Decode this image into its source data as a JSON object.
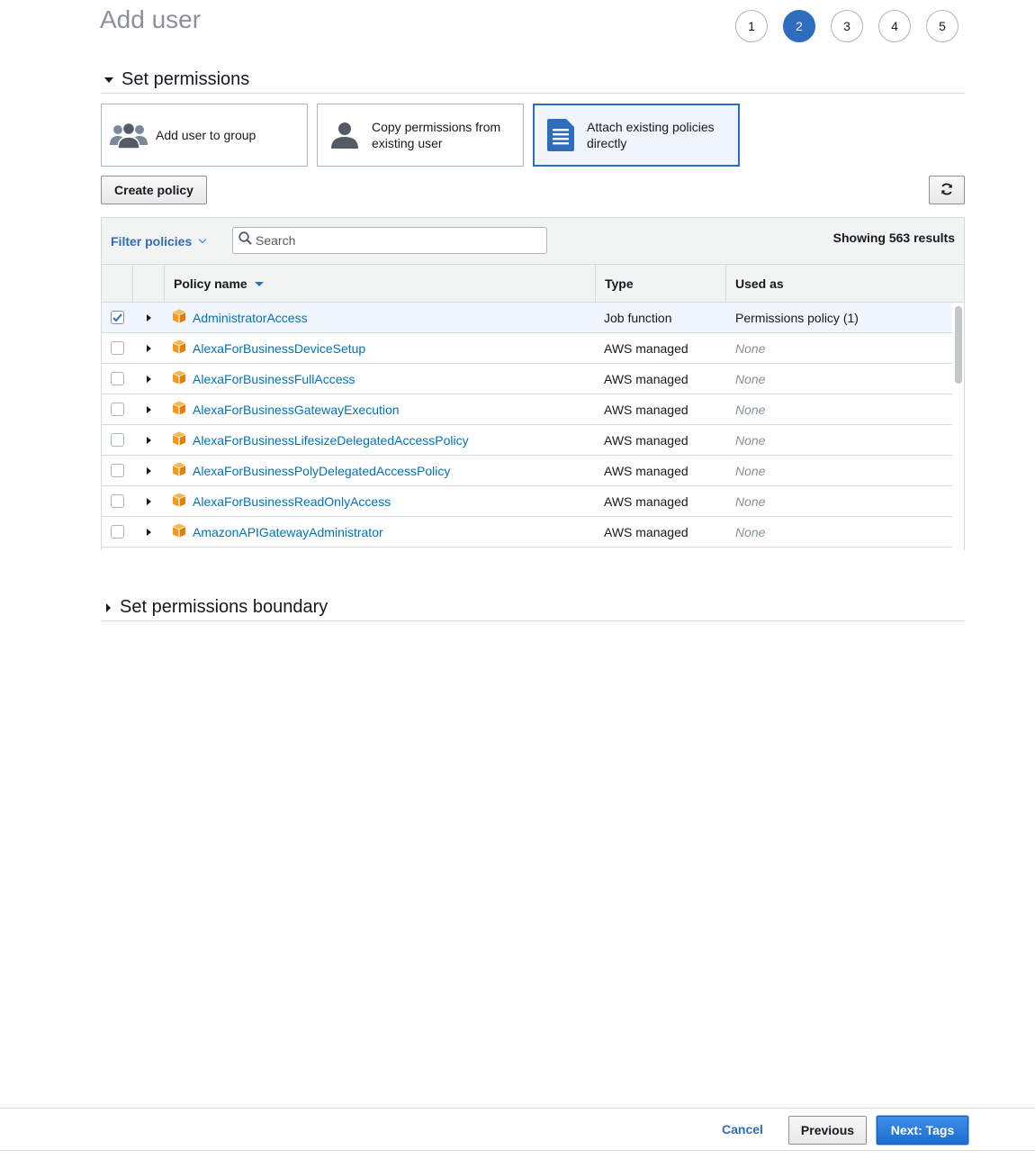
{
  "page": {
    "title": "Add user"
  },
  "steps": [
    {
      "label": "1",
      "active": false
    },
    {
      "label": "2",
      "active": true
    },
    {
      "label": "3",
      "active": false
    },
    {
      "label": "4",
      "active": false
    },
    {
      "label": "5",
      "active": false
    }
  ],
  "permissions": {
    "section_title": "Set permissions",
    "options": [
      {
        "label": "Add user to group",
        "icon": "user-group-icon",
        "selected": false
      },
      {
        "label": "Copy permissions from existing user",
        "icon": "user-icon",
        "selected": false
      },
      {
        "label": "Attach existing policies directly",
        "icon": "document-icon",
        "selected": true
      }
    ],
    "create_policy_label": "Create policy",
    "refresh_icon": "refresh-icon"
  },
  "table": {
    "filter_label": "Filter policies",
    "search_placeholder": "Search",
    "results_text": "Showing 563 results",
    "columns": {
      "name": "Policy name",
      "type": "Type",
      "used_as": "Used as"
    },
    "rows": [
      {
        "name": "AdministratorAccess",
        "type": "Job function",
        "used_as": "Permissions policy (1)",
        "checked": true
      },
      {
        "name": "AlexaForBusinessDeviceSetup",
        "type": "AWS managed",
        "used_as": "None",
        "checked": false
      },
      {
        "name": "AlexaForBusinessFullAccess",
        "type": "AWS managed",
        "used_as": "None",
        "checked": false
      },
      {
        "name": "AlexaForBusinessGatewayExecution",
        "type": "AWS managed",
        "used_as": "None",
        "checked": false
      },
      {
        "name": "AlexaForBusinessLifesizeDelegatedAccessPolicy",
        "type": "AWS managed",
        "used_as": "None",
        "checked": false
      },
      {
        "name": "AlexaForBusinessPolyDelegatedAccessPolicy",
        "type": "AWS managed",
        "used_as": "None",
        "checked": false
      },
      {
        "name": "AlexaForBusinessReadOnlyAccess",
        "type": "AWS managed",
        "used_as": "None",
        "checked": false
      },
      {
        "name": "AmazonAPIGatewayAdministrator",
        "type": "AWS managed",
        "used_as": "None",
        "checked": false
      }
    ]
  },
  "boundary": {
    "section_title": "Set permissions boundary"
  },
  "footer": {
    "cancel_label": "Cancel",
    "previous_label": "Previous",
    "next_label": "Next: Tags"
  },
  "colors": {
    "accent": "#2e6dbd",
    "link": "#0073bb",
    "policy_icon": "#f29a1d"
  }
}
